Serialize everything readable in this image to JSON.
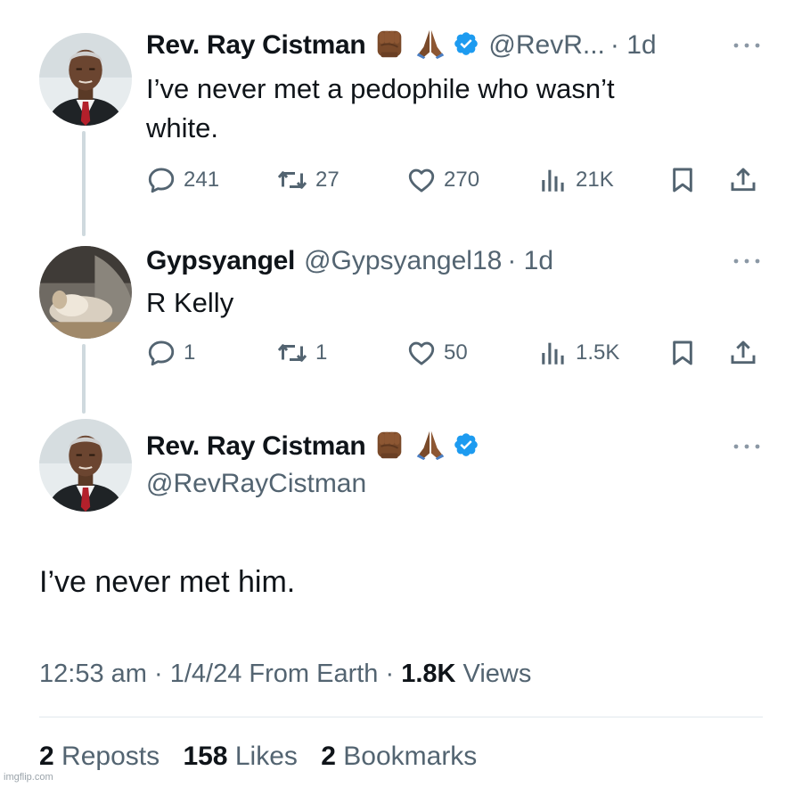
{
  "tweet1": {
    "name": "Rev. Ray Cistman",
    "handle": "@RevR...",
    "time": "· 1d",
    "text_line1": "I’ve never met a pedophile who wasn’t",
    "text_line2": "white.",
    "replies": "241",
    "reposts": "27",
    "likes": "270",
    "views": "21K"
  },
  "tweet2": {
    "name": "Gypsyangel",
    "handle": "@Gypsyangel18",
    "time": "· 1d",
    "text": "R Kelly",
    "replies": "1",
    "reposts": "1",
    "likes": "50",
    "views": "1.5K"
  },
  "main": {
    "name": "Rev. Ray Cistman",
    "handle": "@RevRayCistman",
    "text": "I’ve never met him.",
    "time": "12:53 am",
    "date": "1/4/24",
    "source": "From Earth",
    "views_count": "1.8K",
    "views_label": "Views",
    "reposts_count": "2",
    "reposts_label": "Reposts",
    "likes_count": "158",
    "likes_label": "Likes",
    "bookmarks_count": "2",
    "bookmarks_label": "Bookmarks"
  },
  "watermark": "imgflip.com",
  "icons": {
    "fist": "raised-fist-emoji",
    "hands": "folded-hands-emoji",
    "verified": "verified-badge-icon",
    "reply": "reply-icon",
    "repost": "repost-icon",
    "like": "heart-icon",
    "views": "views-icon",
    "bookmark": "bookmark-icon",
    "share": "share-icon",
    "more": "more-icon"
  },
  "colors": {
    "verified": "#1d9bf0",
    "text": "#0f1419",
    "secondary": "#536471"
  }
}
